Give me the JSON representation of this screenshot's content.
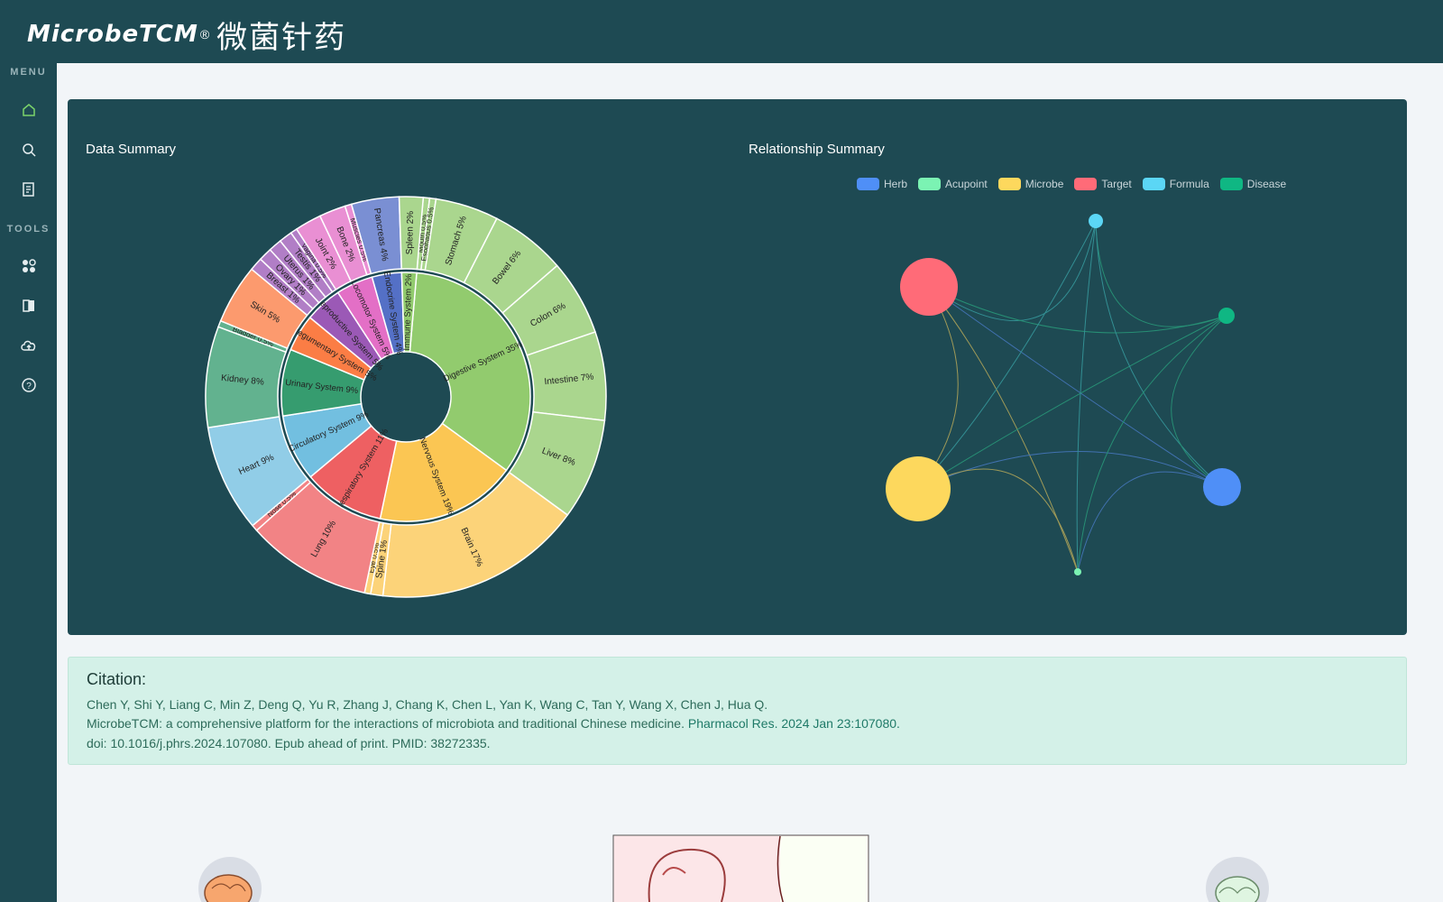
{
  "header": {
    "logo_text": "MicrobeTCM",
    "logo_reg": "®",
    "logo_cn": "微菌针药"
  },
  "sidebar": {
    "menu_heading": "MENU",
    "tools_heading": "TOOLS",
    "items": [
      {
        "icon": "home-icon",
        "active": true
      },
      {
        "icon": "search-icon"
      },
      {
        "icon": "document-list-icon"
      },
      {
        "icon": "tools-grid-icon"
      },
      {
        "icon": "compare-docs-icon"
      },
      {
        "icon": "cloud-upload-icon"
      },
      {
        "icon": "help-icon"
      }
    ]
  },
  "data_summary": {
    "title": "Data Summary"
  },
  "relationship_summary": {
    "title": "Relationship Summary",
    "legend": [
      {
        "name": "Herb",
        "color": "#4f8ff7"
      },
      {
        "name": "Acupoint",
        "color": "#7bf3b3"
      },
      {
        "name": "Microbe",
        "color": "#fdd85d"
      },
      {
        "name": "Target",
        "color": "#ff6b78"
      },
      {
        "name": "Formula",
        "color": "#5bd6f5"
      },
      {
        "name": "Disease",
        "color": "#0fb783"
      }
    ]
  },
  "chart_data": {
    "type": "sunburst",
    "inner": [
      {
        "label": "Digestive System 35%",
        "value": 35,
        "color": "#92cb6e"
      },
      {
        "label": "Nervous System 19%",
        "value": 19,
        "color": "#fbc653"
      },
      {
        "label": "Respiratory System 11%",
        "value": 11,
        "color": "#ee6062"
      },
      {
        "label": "Circulatory System 9%",
        "value": 9,
        "color": "#72bfe0"
      },
      {
        "label": "Urinary System 9%",
        "value": 9,
        "color": "#369c6f"
      },
      {
        "label": "Integumentary System 5%",
        "value": 5,
        "color": "#fb7d45"
      },
      {
        "label": "Reproductive System 5%",
        "value": 5,
        "color": "#9b59b6"
      },
      {
        "label": "Locomotor System 5%",
        "value": 5,
        "color": "#e36fc6"
      },
      {
        "label": "Endocrine System 4%",
        "value": 4,
        "color": "#5470c6"
      },
      {
        "label": "Immune System 2%",
        "value": 2,
        "color": "#92cb6e"
      }
    ],
    "outer": [
      {
        "label": "Mouth 0.5%",
        "parent": 0,
        "value": 0.5
      },
      {
        "label": "Esophagus 0.5%",
        "parent": 0,
        "value": 0.5
      },
      {
        "label": "Stomach 5%",
        "parent": 0,
        "value": 5
      },
      {
        "label": "Bowel 6%",
        "parent": 0,
        "value": 6
      },
      {
        "label": "Colon 6%",
        "parent": 0,
        "value": 6
      },
      {
        "label": "Intestine 7%",
        "parent": 0,
        "value": 7
      },
      {
        "label": "Liver 8%",
        "parent": 0,
        "value": 8
      },
      {
        "label": "Brain 17%",
        "parent": 1,
        "value": 17
      },
      {
        "label": "Spine 1%",
        "parent": 1,
        "value": 1
      },
      {
        "label": "Eye 0.5%",
        "parent": 1,
        "value": 0.5
      },
      {
        "label": "Lung 10%",
        "parent": 2,
        "value": 10
      },
      {
        "label": "Nose 0.5%",
        "parent": 2,
        "value": 0.5
      },
      {
        "label": "Heart 9%",
        "parent": 3,
        "value": 9
      },
      {
        "label": "Kidney 8%",
        "parent": 4,
        "value": 8
      },
      {
        "label": "Bladder 0.5%",
        "parent": 4,
        "value": 0.5
      },
      {
        "label": "Skin 5%",
        "parent": 5,
        "value": 5
      },
      {
        "label": "Breast 1%",
        "parent": 6,
        "value": 1
      },
      {
        "label": "Ovary 1%",
        "parent": 6,
        "value": 1
      },
      {
        "label": "Uterus 1%",
        "parent": 6,
        "value": 1
      },
      {
        "label": "Testis 1%",
        "parent": 6,
        "value": 1
      },
      {
        "label": "Vagina 0.5%",
        "parent": 6,
        "value": 0.5
      },
      {
        "label": "Joint 2%",
        "parent": 7,
        "value": 2
      },
      {
        "label": "Bone 2%",
        "parent": 7,
        "value": 2
      },
      {
        "label": "Muscles 0.5%",
        "parent": 7,
        "value": 0.5
      },
      {
        "label": "Pancreas 4%",
        "parent": 8,
        "value": 4
      },
      {
        "label": "Spleen 2%",
        "parent": 9,
        "value": 2
      }
    ]
  },
  "citation": {
    "title": "Citation:",
    "authors": "Chen Y, Shi Y, Liang C, Min Z, Deng Q, Yu R, Zhang J, Chang K, Chen L, Yan K, Wang C, Tan Y, Wang X, Chen J, Hua Q.",
    "article": "MicrobeTCM: a comprehensive platform for the interactions of microbiota and traditional Chinese medicine.",
    "journal": "Pharmacol Res. 2024 Jan 23:107080.",
    "doi": "doi: 10.1016/j.phrs.2024.107080. Epub ahead of print. PMID: 38272335."
  }
}
